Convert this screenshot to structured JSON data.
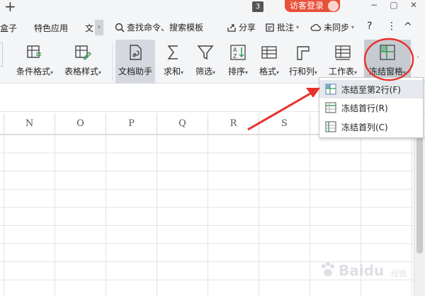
{
  "titlebar": {
    "plus": "+",
    "tab_count": "3",
    "guest_login": "访客登录",
    "minimize": "−",
    "restore": "▢",
    "close": "✕"
  },
  "menu": {
    "tabs": [
      "盒子",
      "特色应用",
      "文"
    ],
    "more": "›",
    "search": "查找命令、搜索模板",
    "share": "分享",
    "annotate": "批注",
    "sync": "未同步",
    "help": "?",
    "more_opts": "⋮",
    "collapse": "^"
  },
  "ribbon": {
    "buttons": [
      {
        "label": "条件格式",
        "icon": "conditional-format-icon"
      },
      {
        "label": "表格样式",
        "icon": "table-style-icon"
      },
      {
        "label": "文档助手",
        "icon": "document-assistant-icon"
      },
      {
        "label": "求和",
        "icon": "sum-icon"
      },
      {
        "label": "筛选",
        "icon": "filter-icon"
      },
      {
        "label": "排序",
        "icon": "sort-icon"
      },
      {
        "label": "格式",
        "icon": "format-icon"
      },
      {
        "label": "行和列",
        "icon": "rows-columns-icon"
      },
      {
        "label": "工作表",
        "icon": "worksheet-icon"
      },
      {
        "label": "冻结窗格",
        "icon": "freeze-panes-icon"
      }
    ]
  },
  "grid": {
    "columns": [
      "N",
      "O",
      "P",
      "Q",
      "R",
      "S"
    ]
  },
  "dropdown": {
    "items": [
      {
        "label": "冻结至第2行(F)",
        "icon": "freeze-row-icon"
      },
      {
        "label": "冻结首行(R)",
        "icon": "freeze-first-row-icon"
      },
      {
        "label": "冻结首列(C)",
        "icon": "freeze-first-column-icon"
      }
    ]
  },
  "watermark": {
    "text": "Baidu",
    "sub": "经验"
  },
  "colors": {
    "guest_red": "#e8503a",
    "annotation_red": "#e8302a",
    "ribbon_bg": "#f4f5f7"
  }
}
